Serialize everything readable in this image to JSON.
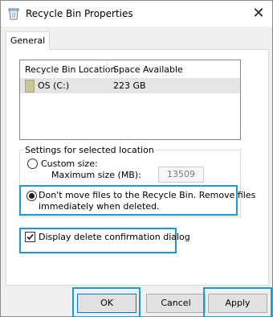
{
  "window": {
    "title": "Recycle Bin Properties",
    "close_glyph": "✕"
  },
  "tabs": [
    {
      "label": "General",
      "selected": true
    }
  ],
  "list": {
    "headers": [
      "Recycle Bin Location",
      "Space Available"
    ],
    "rows": [
      {
        "location": "OS (C:)",
        "space": "223 GB",
        "icon": "drive-icon"
      }
    ]
  },
  "settings": {
    "legend": "Settings for selected location",
    "custom_size_label": "Custom size:",
    "max_size_label": "Maximum size (MB):",
    "max_size_value": "13509",
    "dont_move_label_line1": "Don't move files to the Recycle Bin. Remove files",
    "dont_move_label_line2": "immediately when deleted.",
    "custom_size_selected": false,
    "dont_move_selected": true
  },
  "confirm": {
    "label": "Display delete confirmation dialog",
    "checked": true
  },
  "buttons": {
    "ok": "OK",
    "cancel": "Cancel",
    "apply": "Apply"
  },
  "colors": {
    "highlight": "#1c9ad6",
    "default_button_border": "#0078d7"
  }
}
